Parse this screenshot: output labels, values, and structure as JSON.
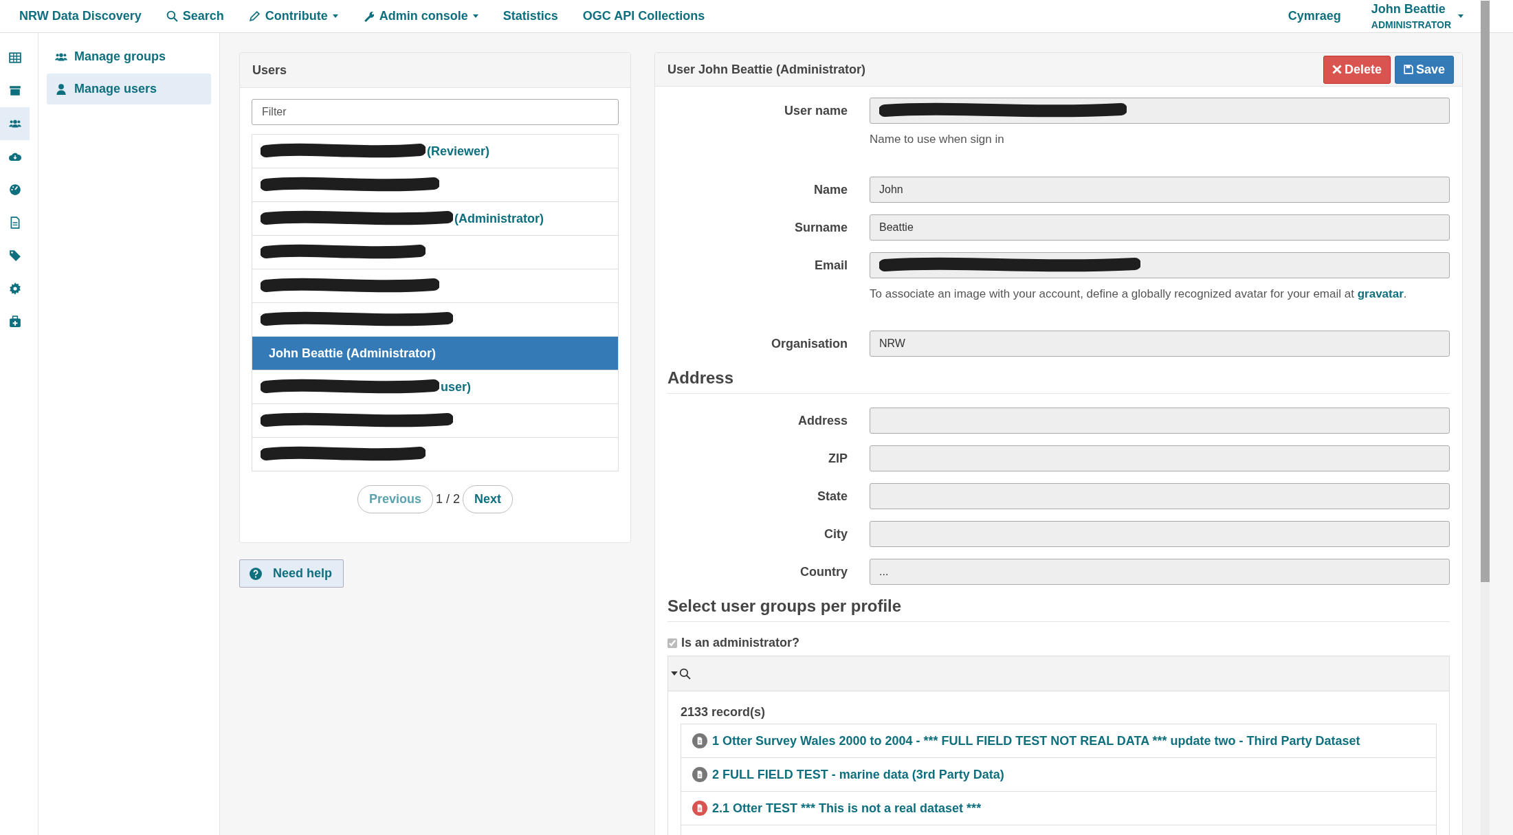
{
  "navbar": {
    "brand": "NRW Data Discovery",
    "items": [
      {
        "label": "Search",
        "dropdown": false
      },
      {
        "label": "Contribute",
        "dropdown": true
      },
      {
        "label": "Admin console",
        "dropdown": true
      },
      {
        "label": "Statistics",
        "dropdown": false
      },
      {
        "label": "OGC API Collections",
        "dropdown": false
      }
    ],
    "language": "Cymraeg",
    "user": {
      "name": "John Beattie",
      "role": "ADMINISTRATOR"
    }
  },
  "icon_rail": [
    {
      "selected": false
    },
    {
      "selected": false
    },
    {
      "selected": true
    },
    {
      "selected": false
    },
    {
      "selected": false
    },
    {
      "selected": false
    },
    {
      "selected": false
    },
    {
      "selected": false
    },
    {
      "selected": false
    }
  ],
  "sidebar": {
    "items": [
      {
        "label": "Manage groups",
        "selected": false
      },
      {
        "label": "Manage users",
        "selected": true
      }
    ]
  },
  "users_panel": {
    "title": "Users",
    "filter": {
      "placeholder": "Filter"
    },
    "users": [
      {
        "redacted": true,
        "visible_text": "(Reviewer)",
        "selected": false
      },
      {
        "redacted": true,
        "selected": false
      },
      {
        "redacted": true,
        "visible_text": "(Administrator)",
        "selected": false
      },
      {
        "redacted": true,
        "selected": false
      },
      {
        "redacted": true,
        "selected": false
      },
      {
        "redacted": true,
        "selected": false
      },
      {
        "redacted": false,
        "visible_text": "John Beattie (Administrator)",
        "selected": true
      },
      {
        "redacted": true,
        "visible_text": "user)",
        "selected": false
      },
      {
        "redacted": true,
        "selected": false
      },
      {
        "redacted": true,
        "selected": false
      }
    ],
    "pager": {
      "previous": "Previous",
      "page": "1 / 2",
      "next": "Next"
    }
  },
  "help_button": "Need help",
  "user_form": {
    "title": "User John Beattie (Administrator)",
    "delete": "Delete",
    "save": "Save",
    "fields": [
      {
        "label": "User name",
        "redacted": true,
        "help": "Name to use when sign in"
      },
      {
        "label": "Name",
        "value": "John"
      },
      {
        "label": "Surname",
        "value": "Beattie"
      },
      {
        "label": "Email",
        "redacted": true,
        "help": "To associate an image with your account, define a globally recognized avatar for your email at",
        "help_link": "gravatar",
        "help_end": "."
      },
      {
        "label": "Organisation",
        "value": "NRW"
      }
    ],
    "address_heading": "Address",
    "address_fields": [
      {
        "label": "Address"
      },
      {
        "label": "ZIP"
      },
      {
        "label": "State"
      },
      {
        "label": "City"
      },
      {
        "label": "Country",
        "value": "..."
      }
    ],
    "groups_heading": "Select user groups per profile",
    "is_admin": {
      "label": "Is an administrator?",
      "checked": true
    },
    "records_count": "2133 record(s)",
    "records": [
      {
        "title": "1 Otter Survey Wales 2000 to 2004 - *** FULL FIELD TEST NOT REAL DATA *** update two - Third Party Dataset",
        "color": "#777777"
      },
      {
        "title": "2 FULL FIELD TEST - marine data (3rd Party Data)",
        "color": "#777777"
      },
      {
        "title": "2.1 Otter TEST *** This is not a real dataset ***",
        "color": "#d9534f"
      }
    ]
  }
}
